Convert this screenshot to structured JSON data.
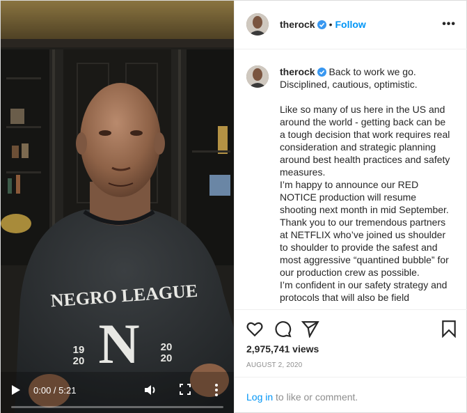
{
  "video": {
    "time": "0:00 / 5:21",
    "shirt_text": "NEGRO LEAGUE",
    "shirt_year_left": [
      "19",
      "20"
    ],
    "shirt_year_right": [
      "20",
      "20"
    ],
    "progress": 0,
    "icons": [
      "play-icon",
      "volume-icon",
      "fullscreen-icon",
      "more-vertical-icon"
    ]
  },
  "header": {
    "username": "therock",
    "follow_label": "Follow",
    "separator": "•",
    "more": "•••"
  },
  "caption": {
    "username": "therock",
    "first_line": "Back to work we go. Disciplined, cautious, optimistic.",
    "paragraphs": [
      "Like so many of us here in the US and around the world - getting back can be a tough decision that work requires real consideration and strategic planning around best health practices and safety measures.",
      "I’m happy to announce our RED NOTICE production will resume shooting next month in mid September.",
      "Thank you to our tremendous partners at NETFLIX who’ve joined us shoulder to shoulder to provide the safest and most aggressive “quantined bubble” for our production crew as possible.",
      "I’m confident in our safety strategy and protocols that will also be field"
    ]
  },
  "actions": {
    "icons": [
      "heart-icon",
      "comment-icon",
      "share-icon",
      "bookmark-icon"
    ],
    "views": "2,975,741 views",
    "date": "AUGUST 2, 2020"
  },
  "login": {
    "link": "Log in",
    "rest": " to like or comment."
  },
  "colors": {
    "accent": "#0095f6",
    "text": "#262626",
    "muted": "#8e8e8e",
    "border": "#dbdbdb"
  }
}
